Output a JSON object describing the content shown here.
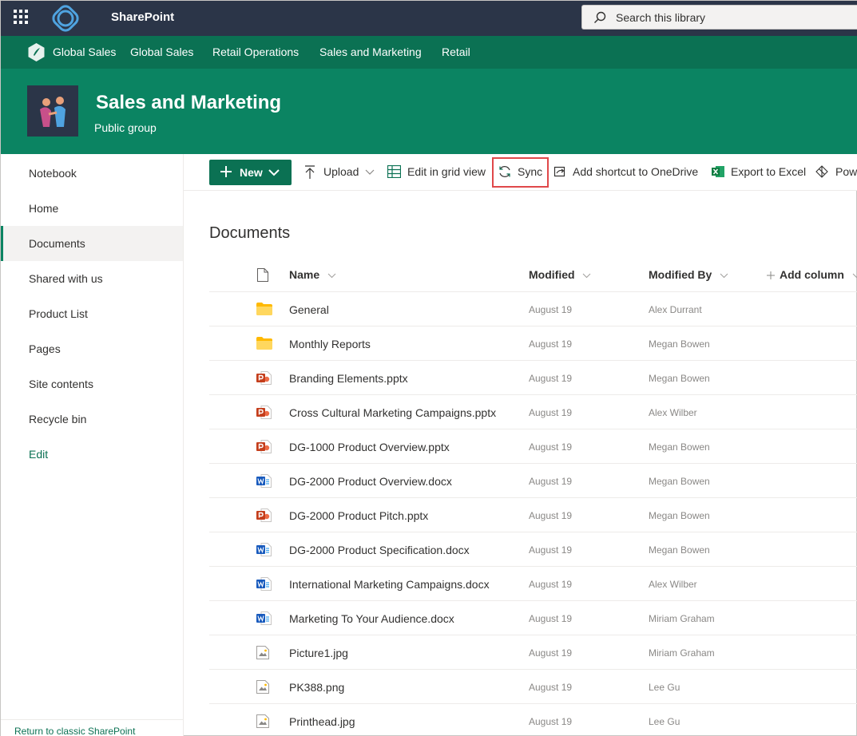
{
  "suite": {
    "app_name": "SharePoint",
    "search_placeholder": "Search this library"
  },
  "hub": {
    "items": [
      "Global Sales",
      "Global Sales",
      "Retail Operations",
      "Sales and Marketing",
      "Retail"
    ]
  },
  "site": {
    "title": "Sales and Marketing",
    "subtitle": "Public group"
  },
  "leftnav": {
    "items": [
      "Notebook",
      "Home",
      "Documents",
      "Shared with us",
      "Product List",
      "Pages",
      "Site contents",
      "Recycle bin"
    ],
    "selected": "Documents",
    "edit_label": "Edit",
    "return_label": "Return to classic SharePoint"
  },
  "commands": {
    "new_label": "New",
    "upload_label": "Upload",
    "grid_label": "Edit in grid view",
    "sync_label": "Sync",
    "shortcut_label": "Add shortcut to OneDrive",
    "export_label": "Export to Excel",
    "power_label": "Pow"
  },
  "library": {
    "title": "Documents",
    "columns": {
      "name": "Name",
      "modified": "Modified",
      "modified_by": "Modified By",
      "add_column": "Add column"
    },
    "rows": [
      {
        "type": "folder",
        "name": "General",
        "modified": "August 19",
        "by": "Alex Durrant"
      },
      {
        "type": "folder",
        "name": "Monthly Reports",
        "modified": "August 19",
        "by": "Megan Bowen"
      },
      {
        "type": "pptx",
        "name": "Branding Elements.pptx",
        "modified": "August 19",
        "by": "Megan Bowen"
      },
      {
        "type": "pptx",
        "name": "Cross Cultural Marketing Campaigns.pptx",
        "modified": "August 19",
        "by": "Alex Wilber"
      },
      {
        "type": "pptx",
        "name": "DG-1000 Product Overview.pptx",
        "modified": "August 19",
        "by": "Megan Bowen"
      },
      {
        "type": "docx",
        "name": "DG-2000 Product Overview.docx",
        "modified": "August 19",
        "by": "Megan Bowen"
      },
      {
        "type": "pptx",
        "name": "DG-2000 Product Pitch.pptx",
        "modified": "August 19",
        "by": "Megan Bowen"
      },
      {
        "type": "docx",
        "name": "DG-2000 Product Specification.docx",
        "modified": "August 19",
        "by": "Megan Bowen"
      },
      {
        "type": "docx",
        "name": "International Marketing Campaigns.docx",
        "modified": "August 19",
        "by": "Alex Wilber"
      },
      {
        "type": "docx",
        "name": "Marketing To Your Audience.docx",
        "modified": "August 19",
        "by": "Miriam Graham"
      },
      {
        "type": "image",
        "name": "Picture1.jpg",
        "modified": "August 19",
        "by": "Miriam Graham"
      },
      {
        "type": "image",
        "name": "PK388.png",
        "modified": "August 19",
        "by": "Lee Gu"
      },
      {
        "type": "image",
        "name": "Printhead.jpg",
        "modified": "August 19",
        "by": "Lee Gu"
      }
    ]
  },
  "colors": {
    "suite_bar": "#2b3548",
    "hub_nav": "#0b7153",
    "site_header": "#0b8462",
    "accent": "#0b7153",
    "highlight": "#e0484a"
  }
}
